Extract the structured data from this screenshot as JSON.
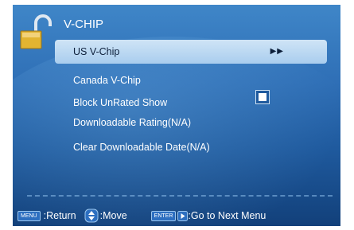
{
  "window": {
    "title": "V-CHIP"
  },
  "menu": {
    "items": [
      {
        "label": "US V-Chip",
        "indicator": "▶▶",
        "selected": true
      },
      {
        "label": "Canada V-Chip"
      },
      {
        "label": "Block UnRated Show",
        "checkbox": true
      },
      {
        "label": "Downloadable Rating(N/A)"
      },
      {
        "label": "Clear Downloadable Date(N/A)"
      }
    ]
  },
  "footer": {
    "menu_key": "MENU",
    "return_label": ":Return",
    "move_label": ":Move",
    "enter_key": "ENTER",
    "next_label": ":Go to Next Menu"
  },
  "icons": {
    "title": "padlock-icon",
    "move": "navigation-pad-icon",
    "next": "play-icon"
  },
  "colors": {
    "panel_top": "#3f86c8",
    "panel_bottom": "#12407a",
    "highlight": "#b8d7f2",
    "text": "#ffffff"
  }
}
